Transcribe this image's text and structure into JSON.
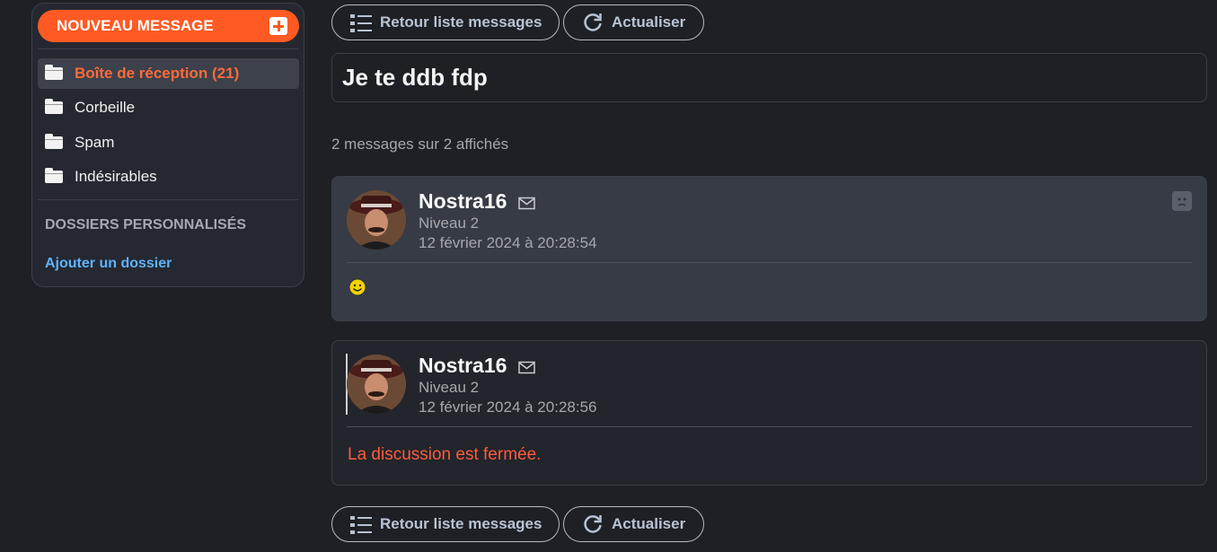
{
  "sidebar": {
    "new_message_label": "NOUVEAU MESSAGE",
    "folders": [
      {
        "label": "Boîte de réception (21)",
        "active": true
      },
      {
        "label": "Corbeille",
        "active": false
      },
      {
        "label": "Spam",
        "active": false
      },
      {
        "label": "Indésirables",
        "active": false
      }
    ],
    "custom_folders_title": "DOSSIERS PERSONNALISÉS",
    "add_folder_label": "Ajouter un dossier"
  },
  "toolbar": {
    "back_label": "Retour liste messages",
    "refresh_label": "Actualiser"
  },
  "thread": {
    "subject": "Je te ddb fdp",
    "count_text": "2 messages sur 2 affichés",
    "messages": [
      {
        "author": "Nostra16",
        "level": "Niveau 2",
        "date": "12 février 2024 à 20:28:54",
        "content": "smiley-icon"
      },
      {
        "author": "Nostra16",
        "level": "Niveau 2",
        "date": "12 février 2024 à 20:28:56",
        "content": "La discussion est fermée."
      }
    ]
  },
  "colors": {
    "accent": "#ff5a23",
    "link": "#5eb4ff",
    "closed": "#ff5a3c",
    "background": "#1e2025"
  }
}
